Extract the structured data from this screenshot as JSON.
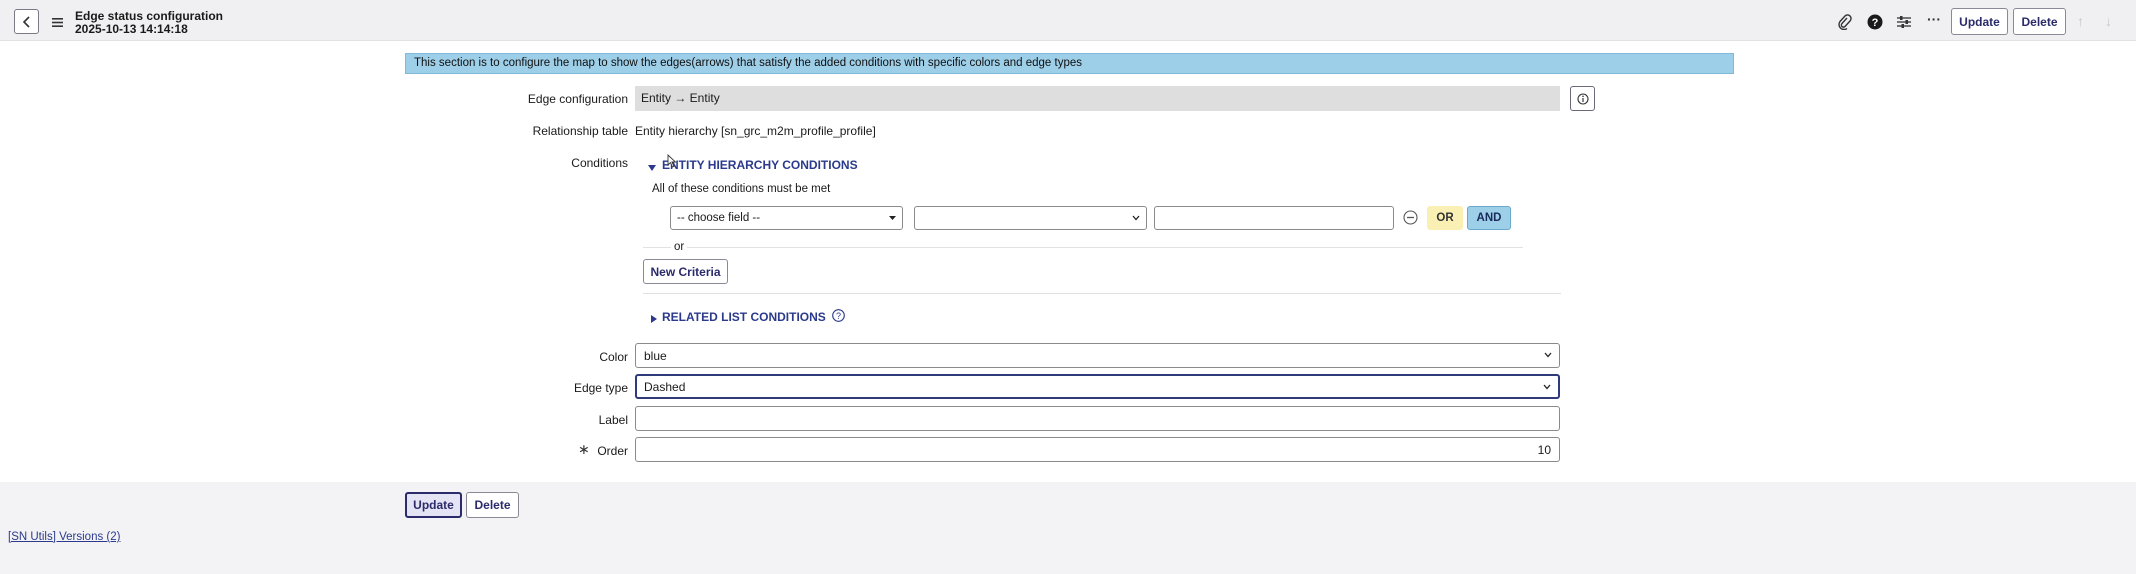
{
  "header": {
    "title": "Edge status configuration",
    "subtitle": "2025-10-13 14:14:18",
    "update_label": "Update",
    "delete_label": "Delete",
    "more_label": "···"
  },
  "banner": {
    "text": "This section is to configure the map to show the edges(arrows) that satisfy the added conditions with specific colors and edge types"
  },
  "form": {
    "edge_configuration": {
      "label": "Edge configuration",
      "value": "Entity → Entity"
    },
    "relationship_table": {
      "label": "Relationship table",
      "value": "Entity hierarchy [sn_grc_m2m_profile_profile]"
    },
    "conditions": {
      "label": "Conditions",
      "section_title": "ENTITY HIERARCHY CONDITIONS",
      "all_met_text": "All of these conditions must be met",
      "field_select": "-- choose field --",
      "operator_select": "",
      "value_input": "",
      "or_label": "OR",
      "and_label": "AND",
      "or_separator": "or",
      "new_criteria_label": "New Criteria",
      "related_title": "RELATED LIST CONDITIONS"
    },
    "color": {
      "label": "Color",
      "value": "blue"
    },
    "edge_type": {
      "label": "Edge type",
      "value": "Dashed"
    },
    "label_field": {
      "label": "Label",
      "value": ""
    },
    "order": {
      "label": "Order",
      "required_mark": "∗",
      "value": "10"
    }
  },
  "footer": {
    "update_label": "Update",
    "delete_label": "Delete",
    "versions_link": "[SN Utils] Versions (2)"
  },
  "colors": {
    "banner_bg": "#9ecfe8",
    "or_bg": "#fbf0b4",
    "and_bg": "#9ecfe8",
    "link": "#2b3a8c"
  }
}
